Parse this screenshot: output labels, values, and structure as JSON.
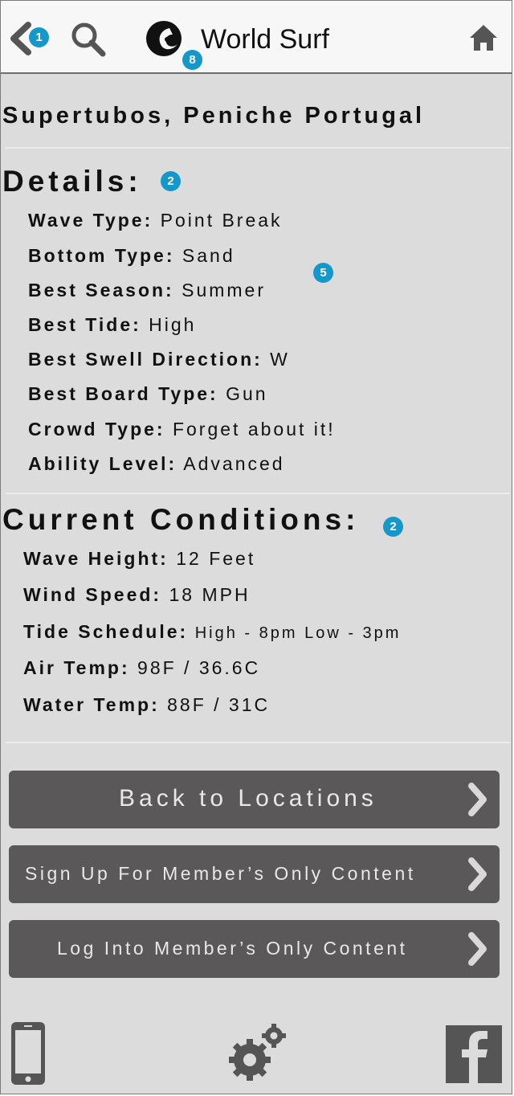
{
  "header": {
    "app_title": "World Surf",
    "back_icon": "chevron-left-icon",
    "search_icon": "search-icon",
    "logo_icon": "wave-logo-icon",
    "home_icon": "home-icon"
  },
  "annotations": {
    "back": "1",
    "logo": "8",
    "details": "2",
    "details_list": "5",
    "conditions": "2"
  },
  "location": "Supertubos, Peniche Portugal",
  "details": {
    "title": "Details:",
    "items": [
      {
        "label": "Wave Type:",
        "value": " Point Break"
      },
      {
        "label": "Bottom Type:",
        "value": " Sand"
      },
      {
        "label": "Best Season:",
        "value": " Summer"
      },
      {
        "label": "Best Tide:",
        "value": " High"
      },
      {
        "label": "Best Swell Direction:",
        "value": " W"
      },
      {
        "label": "Best Board Type:",
        "value": " Gun"
      },
      {
        "label": "Crowd Type:",
        "value": " Forget about it!"
      },
      {
        "label": "Ability Level:",
        "value": " Advanced"
      }
    ]
  },
  "conditions": {
    "title": "Current Conditions:",
    "items": [
      {
        "label": "Wave Height:",
        "value": " 12 Feet"
      },
      {
        "label": "Wind Speed:",
        "value": " 18 MPH"
      },
      {
        "label": "Tide Schedule:",
        "value": " High - 8pm Low - 3pm"
      },
      {
        "label": "Air Temp:",
        "value": " 98F / 36.6C"
      },
      {
        "label": "Water Temp:",
        "value": " 88F / 31C"
      }
    ]
  },
  "buttons": {
    "back_to_locations": "Back to Locations",
    "sign_up": "Sign Up For Member’s Only Content",
    "log_in": "Log Into Member’s Only Content"
  },
  "footer": {
    "left_icon": "mobile-phone-icon",
    "center_icon": "settings-gears-icon",
    "right_icon": "facebook-icon"
  },
  "colors": {
    "background": "#dcdcdc",
    "header_bg": "#f7f7f7",
    "button_bg": "#5a5859",
    "badge": "#1497c9",
    "icon_gray": "#555555"
  }
}
